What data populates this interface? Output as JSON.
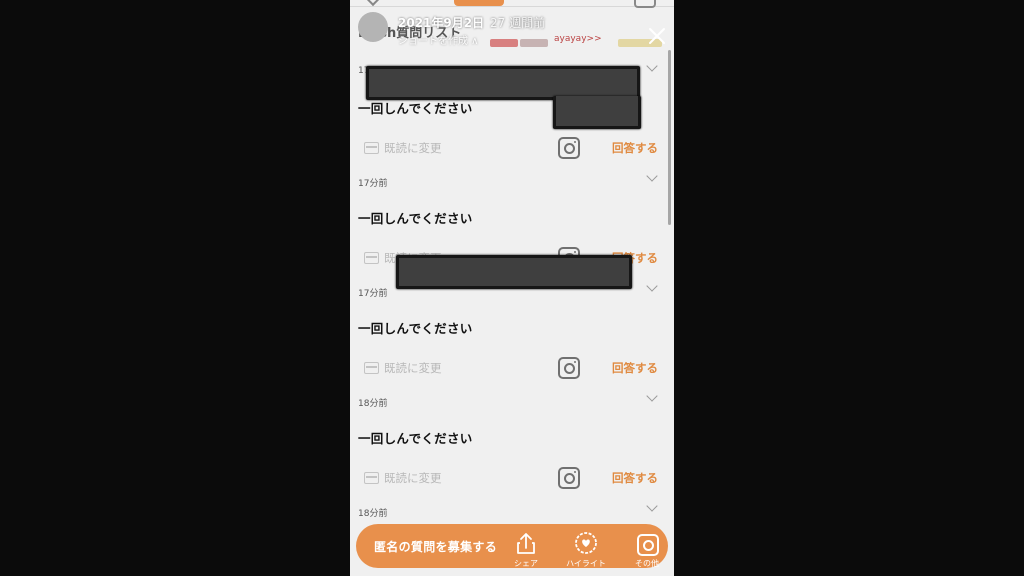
{
  "story": {
    "date": "2021年9月2日",
    "ago": "27 週間前",
    "subtitle": "ショートを作成 ∧"
  },
  "page_title": "B●sh質問リスト",
  "thumb_label": "ayayay>>",
  "cards": [
    {
      "time": "17",
      "question": "一回しんでください",
      "read_label": "既読に変更",
      "answer_label": "回答する"
    },
    {
      "time": "17分前",
      "question": "一回しんでください",
      "read_label": "既読に変更",
      "answer_label": "回答する"
    },
    {
      "time": "17分前",
      "question": "一回しんでください",
      "read_label": "既読に変更",
      "answer_label": "回答する"
    },
    {
      "time": "18分前",
      "question": "一回しんでください",
      "read_label": "既読に変更",
      "answer_label": "回答する"
    }
  ],
  "last_time": "18分前",
  "bottom_bar": {
    "recruit_label": "匿名の質問を募集する",
    "share_label": "シェア",
    "highlight_label": "ハイライト",
    "other_label": "その他"
  },
  "colors": {
    "accent": "#e8904c",
    "answer_text": "#e08a40",
    "background": "#f0f0f0",
    "frame": "#0b0b0b"
  },
  "icons": [
    "close-icon",
    "box-icon",
    "instagram-icon",
    "chevron-down-icon",
    "share-icon",
    "heart-icon"
  ]
}
